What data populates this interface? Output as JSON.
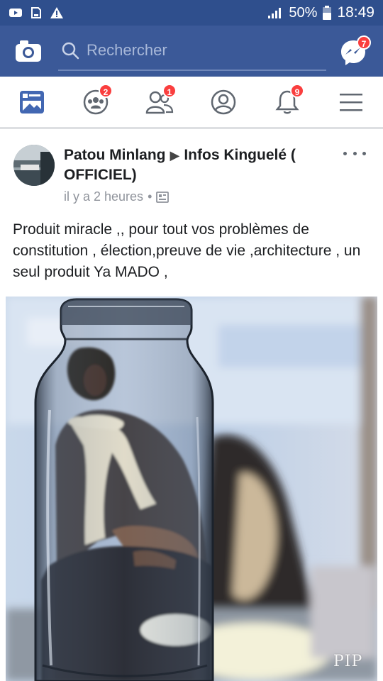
{
  "status_bar": {
    "battery": "50%",
    "time": "18:49"
  },
  "topbar": {
    "search_placeholder": "Rechercher",
    "messenger_badge": "7"
  },
  "nav": {
    "friends_badge": "2",
    "requests_badge": "1",
    "notifications_badge": "9"
  },
  "post": {
    "author": "Patou Minlang",
    "target": "Infos Kinguelé ( OFFICIEL)",
    "timestamp": "il y a 2 heures",
    "text": "Produit miracle ,, pour tout vos problèmes de constitution , élection,preuve de vie ,architecture , un seul produit Ya MADO ,",
    "watermark": "PIP"
  },
  "colors": {
    "brand": "#3b5998",
    "status_bar": "#2f4f8d",
    "badge": "#fa3e3e"
  },
  "icons": {
    "camera": "camera-icon",
    "search": "search-icon",
    "messenger": "messenger-icon",
    "news_feed": "news-feed-icon",
    "groups": "groups-icon",
    "friend_requests": "friend-requests-icon",
    "profile": "profile-icon",
    "notifications": "bell-icon",
    "menu": "hamburger-menu-icon",
    "privacy": "public-icon"
  }
}
